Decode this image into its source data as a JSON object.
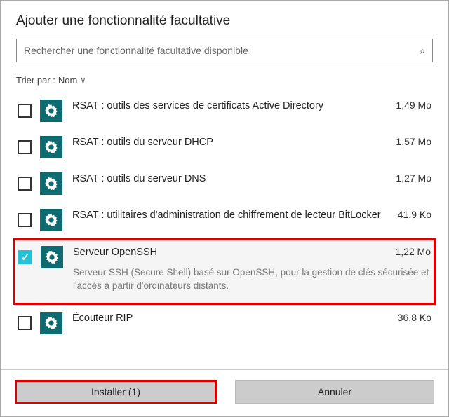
{
  "title": "Ajouter une fonctionnalité facultative",
  "search": {
    "placeholder": "Rechercher une fonctionnalité facultative disponible"
  },
  "sort": {
    "label": "Trier par :",
    "value": "Nom"
  },
  "items": [
    {
      "name": "RSAT : outils des services de certificats Active Directory",
      "size": "1,49 Mo",
      "checked": false
    },
    {
      "name": "RSAT : outils du serveur DHCP",
      "size": "1,57 Mo",
      "checked": false
    },
    {
      "name": "RSAT : outils du serveur DNS",
      "size": "1,27 Mo",
      "checked": false
    },
    {
      "name": "RSAT : utilitaires d'administration de chiffrement de lecteur BitLocker",
      "size": "41,9 Ko",
      "checked": false
    },
    {
      "name": "Serveur OpenSSH",
      "size": "1,22 Mo",
      "checked": true,
      "description": "Serveur SSH (Secure Shell) basé sur OpenSSH, pour la gestion de clés sécurisée et l'accès à partir d'ordinateurs distants."
    },
    {
      "name": "Écouteur RIP",
      "size": "36,8 Ko",
      "checked": false
    }
  ],
  "buttons": {
    "install": "Installer (1)",
    "cancel": "Annuler"
  },
  "colors": {
    "accent": "#0f6b6f",
    "check": "#29c0d6",
    "highlight": "#d00"
  }
}
